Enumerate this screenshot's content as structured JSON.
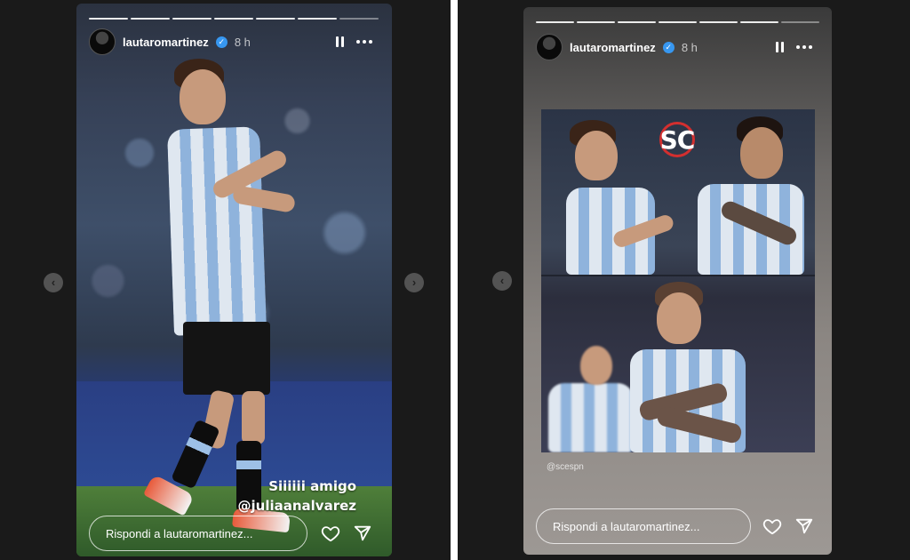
{
  "stories": [
    {
      "username": "lautaromartinez",
      "time": "8 h",
      "caption_lines": [
        "Siiiiii amigo",
        "@juliaanalvarez"
      ],
      "reply_placeholder": "Rispondi a lautaromartinez...",
      "progress_segments": 7
    },
    {
      "username": "lautaromartinez",
      "time": "8 h",
      "logo_text": "SC",
      "credit": "@scespn",
      "reply_placeholder": "Rispondi a lautaromartinez...",
      "progress_segments": 7
    }
  ],
  "icons": {
    "verified": "verified-badge-icon",
    "pause": "pause-icon",
    "more": "more-options-icon",
    "like": "heart-icon",
    "share": "send-icon",
    "prev": "chevron-left-icon",
    "next": "chevron-right-icon"
  },
  "colors": {
    "background": "#1a1a1a",
    "verified": "#3797f0",
    "logo_ring": "#d32f2f"
  }
}
